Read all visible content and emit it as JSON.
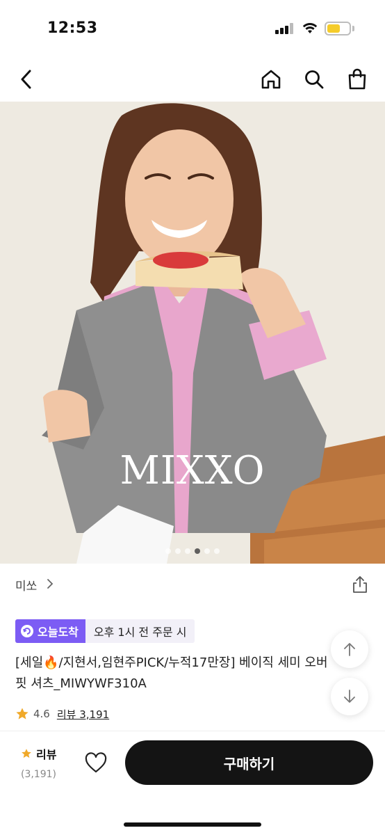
{
  "status": {
    "time": "12:53",
    "battery_color": "#f5cc2a"
  },
  "nav": {
    "back_icon": "chevron-left-icon",
    "home_icon": "home-icon",
    "search_icon": "search-icon",
    "cart_icon": "shopping-bag-icon"
  },
  "hero": {
    "brand_overlay": "MIXXO",
    "carousel": {
      "total": 6,
      "active_index": 4
    }
  },
  "product": {
    "brand": "미쏘",
    "delivery_badge": "오늘도착",
    "delivery_text": "오후 1시 전 주문 시",
    "title_line1": "[세일🔥/지현서,임현주PICK/누적17만장] 베이직 세미 오버",
    "title_line2": "핏 셔츠_MIWYWF310A",
    "rating": "4.6",
    "review_link": "리뷰 3,191"
  },
  "bottom_bar": {
    "review_label": "리뷰",
    "review_count": "(3,191)",
    "buy_label": "구매하기"
  },
  "colors": {
    "accent": "#7c5cf4",
    "buy_button": "#141414",
    "star": "#f0a92a"
  }
}
